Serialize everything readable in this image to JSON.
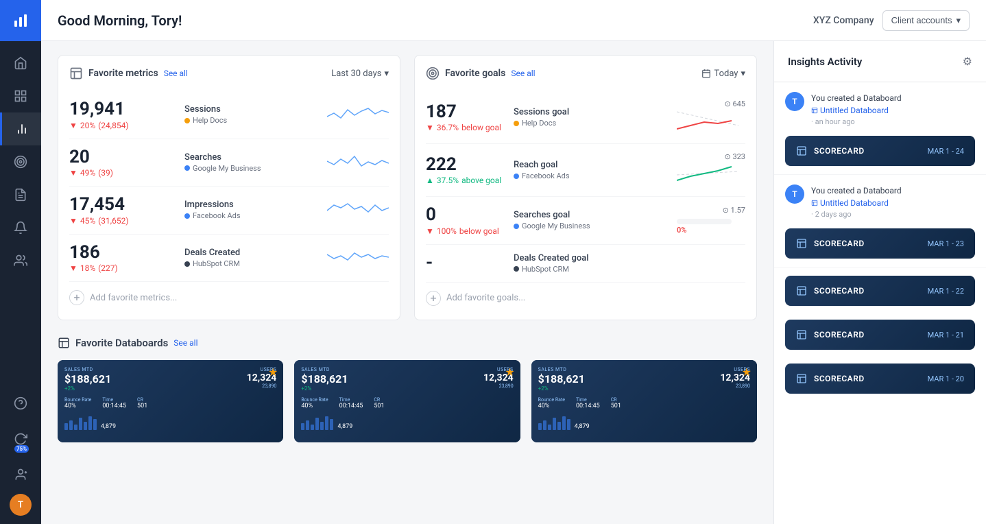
{
  "sidebar": {
    "logo_icon": "chart-bar-icon",
    "items": [
      {
        "id": "home",
        "icon": "home-icon",
        "active": false
      },
      {
        "id": "numbers",
        "icon": "numbers-icon",
        "active": false
      },
      {
        "id": "analytics",
        "icon": "analytics-icon",
        "active": true
      },
      {
        "id": "goals",
        "icon": "goals-icon",
        "active": false
      },
      {
        "id": "reports",
        "icon": "reports-icon",
        "active": false
      },
      {
        "id": "notifications",
        "icon": "bell-icon",
        "active": false
      },
      {
        "id": "team",
        "icon": "team-icon",
        "active": false
      }
    ],
    "bottom_items": [
      {
        "id": "help",
        "icon": "help-icon"
      },
      {
        "id": "updates",
        "icon": "updates-icon",
        "badge": "75%"
      },
      {
        "id": "users",
        "icon": "users-icon"
      }
    ],
    "avatar_label": "T"
  },
  "header": {
    "title": "Good Morning, Tory!",
    "company": "XYZ Company",
    "client_accounts_label": "Client accounts",
    "chevron_icon": "chevron-down-icon"
  },
  "metrics_panel": {
    "icon": "bar-chart-icon",
    "title": "Favorite metrics",
    "see_all": "See all",
    "filter_label": "Last 30 days",
    "filter_icon": "chevron-down-icon",
    "metrics": [
      {
        "value": "19,941",
        "change_pct": "20%",
        "change_dir": "down",
        "change_abs": "(24,854)",
        "label": "Sessions",
        "source": "Help Docs",
        "source_color": "orange"
      },
      {
        "value": "20",
        "change_pct": "49%",
        "change_dir": "down",
        "change_abs": "(39)",
        "label": "Searches",
        "source": "Google My Business",
        "source_color": "blue"
      },
      {
        "value": "17,454",
        "change_pct": "45%",
        "change_dir": "down",
        "change_abs": "(31,652)",
        "label": "Impressions",
        "source": "Facebook Ads",
        "source_color": "blue"
      },
      {
        "value": "186",
        "change_pct": "18%",
        "change_dir": "down",
        "change_abs": "(227)",
        "label": "Deals Created",
        "source": "HubSpot CRM",
        "source_color": "dark"
      }
    ],
    "add_label": "Add favorite metrics..."
  },
  "goals_panel": {
    "icon": "target-icon",
    "title": "Favorite goals",
    "see_all": "See all",
    "filter_label": "Today",
    "filter_icon": "chevron-down-icon",
    "goals": [
      {
        "value": "187",
        "change_pct": "36.7%",
        "change_dir": "down",
        "change_text": "below goal",
        "label": "Sessions goal",
        "source": "Help Docs",
        "source_color": "orange",
        "target": "645",
        "has_progress": false
      },
      {
        "value": "222",
        "change_pct": "37.5%",
        "change_dir": "up",
        "change_text": "above goal",
        "label": "Reach goal",
        "source": "Facebook Ads",
        "source_color": "blue",
        "target": "323",
        "has_progress": false
      },
      {
        "value": "0",
        "change_pct": "100%",
        "change_dir": "down",
        "change_text": "below goal",
        "label": "Searches goal",
        "source": "Google My Business",
        "source_color": "blue",
        "target": "1.57",
        "progress_text": "0%",
        "has_progress": true
      },
      {
        "value": "-",
        "change_pct": "",
        "change_dir": "",
        "change_text": "",
        "label": "Deals Created goal",
        "source": "HubSpot CRM",
        "source_color": "dark",
        "target": "",
        "has_progress": false
      }
    ],
    "add_label": "Add favorite goals..."
  },
  "databoards_section": {
    "icon": "databoard-icon",
    "title": "Favorite Databoards",
    "see_all": "See all",
    "cards": [
      {
        "sales_mtd_label": "SALES MTD",
        "main_value": "$188,621",
        "users_label": "USERS",
        "users_value": "12,324",
        "change": "+2%",
        "visits": "23,890",
        "bounce": "40%",
        "time": "00:14:45",
        "additional": "501",
        "bottom_value": "4,879",
        "starred": true
      },
      {
        "sales_mtd_label": "SALES MTD",
        "main_value": "$188,621",
        "users_label": "USERS",
        "users_value": "12,324",
        "change": "+2%",
        "visits": "23,890",
        "bounce": "40%",
        "time": "00:14:45",
        "additional": "501",
        "bottom_value": "4,879",
        "starred": true
      },
      {
        "sales_mtd_label": "SALES MTD",
        "main_value": "$188,621",
        "users_label": "USERS",
        "users_value": "12,324",
        "change": "+2%",
        "visits": "23,890",
        "bounce": "40%",
        "time": "00:14:45",
        "additional": "501",
        "bottom_value": "4,879",
        "starred": true
      }
    ]
  },
  "insights_panel": {
    "title": "Insights Activity",
    "filter_icon": "filter-icon",
    "activities": [
      {
        "avatar": "T",
        "text_before": "You created a Databoard",
        "link_icon": "databoard-icon",
        "link_text": "Untitled Databoard",
        "time": "an hour ago"
      },
      {
        "avatar": "T",
        "text_before": "You created a Databoard",
        "link_icon": "databoard-icon",
        "link_text": "Untitled Databoard",
        "time": "2 days ago"
      }
    ],
    "scorecards": [
      {
        "label": "SCORECARD",
        "date": "MAR 1 - 24"
      },
      {
        "label": "SCORECARD",
        "date": "MAR 1 - 23"
      },
      {
        "label": "SCORECARD",
        "date": "MAR 1 - 22"
      },
      {
        "label": "SCORECARD",
        "date": "MAR 1 - 21"
      },
      {
        "label": "SCORECARD",
        "date": "MAR 1 - 20"
      }
    ]
  }
}
